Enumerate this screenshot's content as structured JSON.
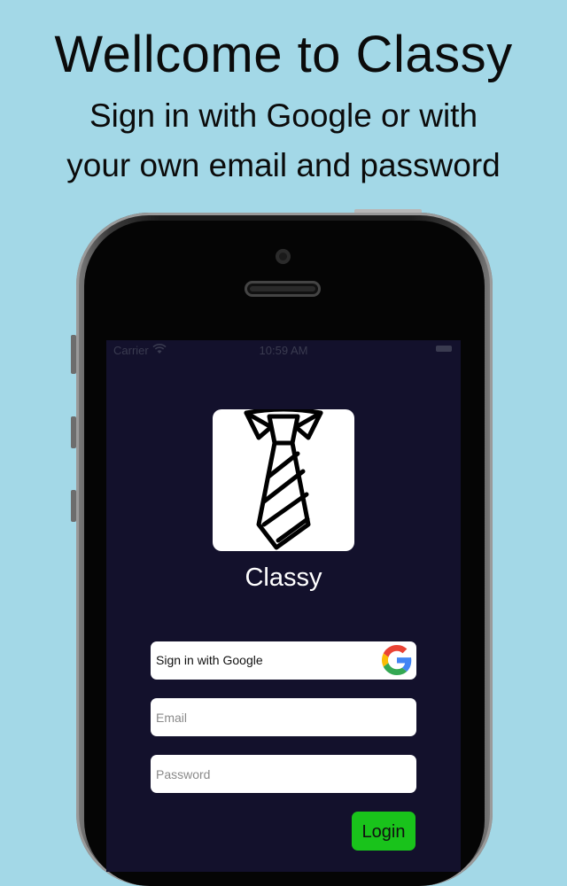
{
  "promo": {
    "headline": "Wellcome to Classy",
    "subline_1": "Sign in with Google or with",
    "subline_2": "your own email and password"
  },
  "status_bar": {
    "carrier": "Carrier",
    "time": "10:59 AM",
    "wifi_icon": "wifi-icon",
    "battery_icon": "battery-icon"
  },
  "app": {
    "name": "Classy",
    "logo_icon": "tie-icon"
  },
  "sign_in": {
    "google_label": "Sign in with Google",
    "google_icon": "google-g-icon",
    "email_placeholder": "Email",
    "password_placeholder": "Password",
    "login_label": "Login"
  },
  "colors": {
    "background": "#a3d8e7",
    "screen": "#13112c",
    "login_button": "#19c31b",
    "field": "#ffffff"
  }
}
